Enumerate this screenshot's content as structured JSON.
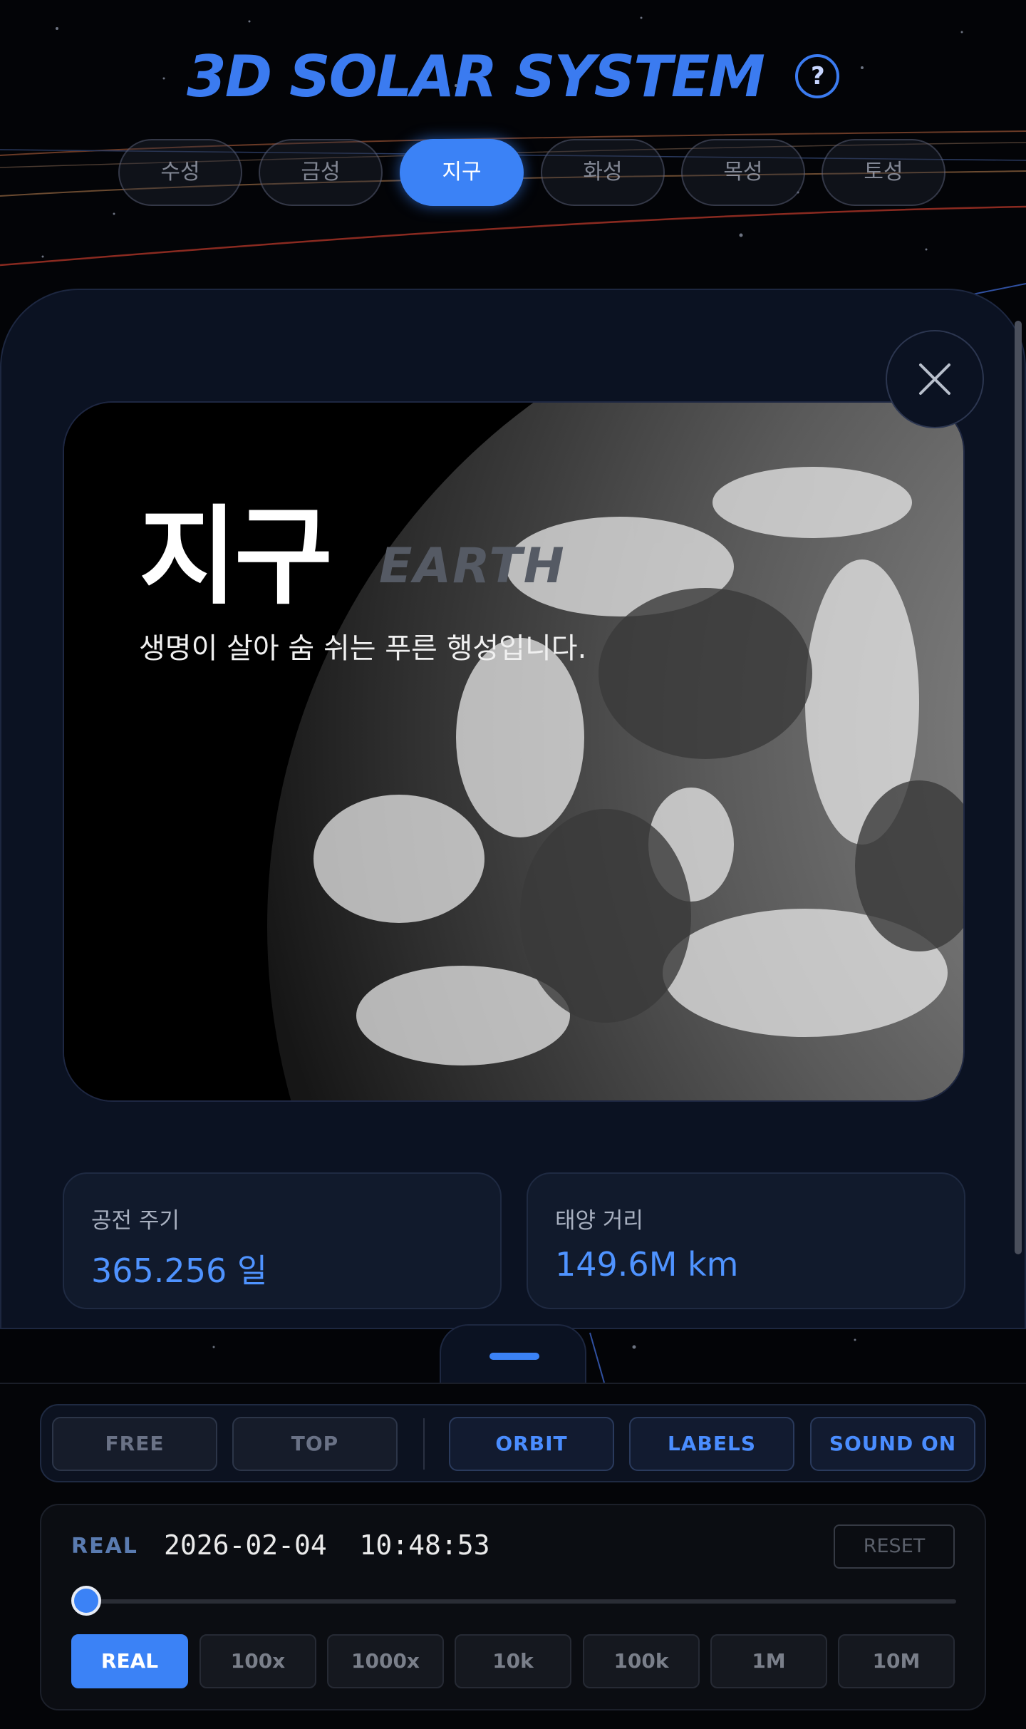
{
  "header": {
    "title": "3D SOLAR SYSTEM",
    "help_label": "?"
  },
  "planet_tabs": [
    {
      "label": "수성",
      "active": false
    },
    {
      "label": "금성",
      "active": false
    },
    {
      "label": "지구",
      "active": true
    },
    {
      "label": "화성",
      "active": false
    },
    {
      "label": "목성",
      "active": false
    },
    {
      "label": "토성",
      "active": false
    }
  ],
  "panel": {
    "name": "지구",
    "english_name": "EARTH",
    "description": "생명이 살아 숨 쉬는 푸른 행성입니다.",
    "stats": [
      {
        "label": "공전 주기",
        "value": "365.256 일"
      },
      {
        "label": "태양 거리",
        "value": "149.6M km"
      }
    ]
  },
  "view_controls": {
    "camera": [
      {
        "label": "FREE"
      },
      {
        "label": "TOP"
      }
    ],
    "toggles": [
      {
        "label": "ORBIT"
      },
      {
        "label": "LABELS"
      },
      {
        "label": "SOUND ON"
      }
    ]
  },
  "time": {
    "mode_label": "REAL",
    "datetime": "2026-02-04  10:48:53",
    "reset_label": "RESET",
    "slider_value": 0,
    "speeds": [
      {
        "label": "REAL",
        "active": true
      },
      {
        "label": "100x",
        "active": false
      },
      {
        "label": "1000x",
        "active": false
      },
      {
        "label": "10k",
        "active": false
      },
      {
        "label": "100k",
        "active": false
      },
      {
        "label": "1M",
        "active": false
      },
      {
        "label": "10M",
        "active": false
      }
    ]
  },
  "colors": {
    "accent": "#3b82f6",
    "title": "#3b7bf0",
    "stat_value": "#4f93ff"
  }
}
